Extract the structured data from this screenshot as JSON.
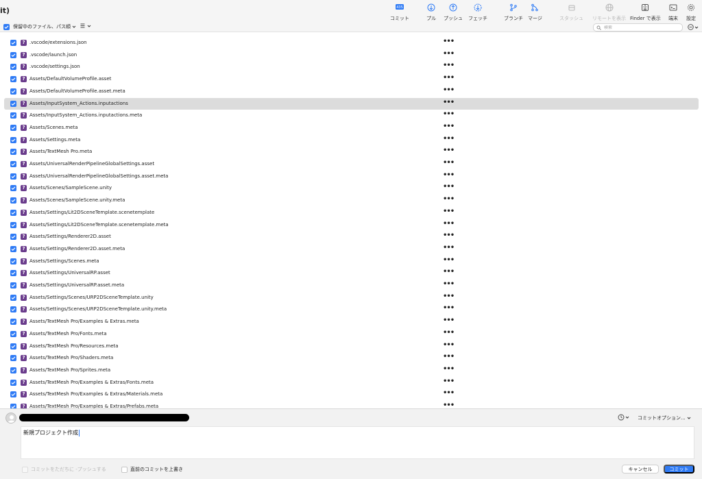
{
  "window": {
    "title_fragment": "it)"
  },
  "toolbar": {
    "commit": "コミット",
    "commit_badge": "435",
    "pull": "プル",
    "push": "プッシュ",
    "fetch": "フェッチ",
    "branch": "ブランチ",
    "merge": "マージ",
    "stash": "スタッシュ",
    "show_remote": "リモートを表示",
    "show_in_finder": "Finder で表示",
    "terminal": "端末",
    "settings": "設定"
  },
  "filter": {
    "label": "保留中のファイル、パス順",
    "search_placeholder": "検索"
  },
  "files": [
    ".vscode/extensions.json",
    ".vscode/launch.json",
    ".vscode/settings.json",
    "Assets/DefaultVolumeProfile.asset",
    "Assets/DefaultVolumeProfile.asset.meta",
    "Assets/InputSystem_Actions.inputactions",
    "Assets/InputSystem_Actions.inputactions.meta",
    "Assets/Scenes.meta",
    "Assets/Settings.meta",
    "Assets/TextMesh Pro.meta",
    "Assets/UniversalRenderPipelineGlobalSettings.asset",
    "Assets/UniversalRenderPipelineGlobalSettings.asset.meta",
    "Assets/Scenes/SampleScene.unity",
    "Assets/Scenes/SampleScene.unity.meta",
    "Assets/Settings/Lit2DSceneTemplate.scenetemplate",
    "Assets/Settings/Lit2DSceneTemplate.scenetemplate.meta",
    "Assets/Settings/Renderer2D.asset",
    "Assets/Settings/Renderer2D.asset.meta",
    "Assets/Settings/Scenes.meta",
    "Assets/Settings/UniversalRP.asset",
    "Assets/Settings/UniversalRP.asset.meta",
    "Assets/Settings/Scenes/URP2DSceneTemplate.unity",
    "Assets/Settings/Scenes/URP2DSceneTemplate.unity.meta",
    "Assets/TextMesh Pro/Examples & Extras.meta",
    "Assets/TextMesh Pro/Fonts.meta",
    "Assets/TextMesh Pro/Resources.meta",
    "Assets/TextMesh Pro/Shaders.meta",
    "Assets/TextMesh Pro/Sprites.meta",
    "Assets/TextMesh Pro/Examples & Extras/Fonts.meta",
    "Assets/TextMesh Pro/Examples & Extras/Materials.meta",
    "Assets/TextMesh Pro/Examples & Extras/Prefabs.meta"
  ],
  "file_status_glyph": "?",
  "file_more_glyph": "•••",
  "selected_file": "Assets/InputSystem_Actions.inputactions",
  "commit_panel": {
    "message": "新規プロジェクト作成",
    "options_label": "コミットオプション...",
    "push_immediately_label": "コミットをただちに -プッシュする",
    "amend_label": "直前のコミットを上書き",
    "cancel_label": "キャンセル",
    "commit_label": "コミット"
  },
  "colors": {
    "accent": "#2f7bf5",
    "untracked_badge": "#6a3c8c",
    "selected_row": "#dcdcdc"
  }
}
